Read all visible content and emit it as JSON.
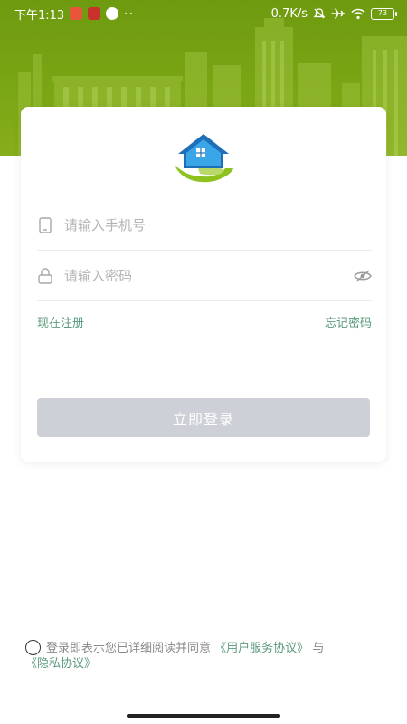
{
  "status_bar": {
    "time": "下午1:13",
    "network_speed": "0.7K/s",
    "battery_level": "73",
    "dots": "··"
  },
  "login_form": {
    "phone_placeholder": "请输入手机号",
    "password_placeholder": "请输入密码",
    "register_label": "现在注册",
    "forgot_password_label": "忘记密码",
    "login_button_label": "立即登录"
  },
  "agreement": {
    "prefix": "登录即表示您已详细阅读并同意",
    "user_agreement_link": "《用户服务协议》",
    "conjunction": "与",
    "privacy_link": "《隐私协议》",
    "checked": false
  },
  "colors": {
    "header_green": "#7aa514",
    "link_green": "#5a9a7c",
    "button_disabled": "#cdd0d6",
    "logo_blue": "#1e6fb8",
    "logo_green": "#8dc21f"
  },
  "icons": {
    "phone": "mobile-phone-icon",
    "password": "lock-icon",
    "visibility": "eye-off-icon",
    "logo": "house-hand-logo"
  }
}
